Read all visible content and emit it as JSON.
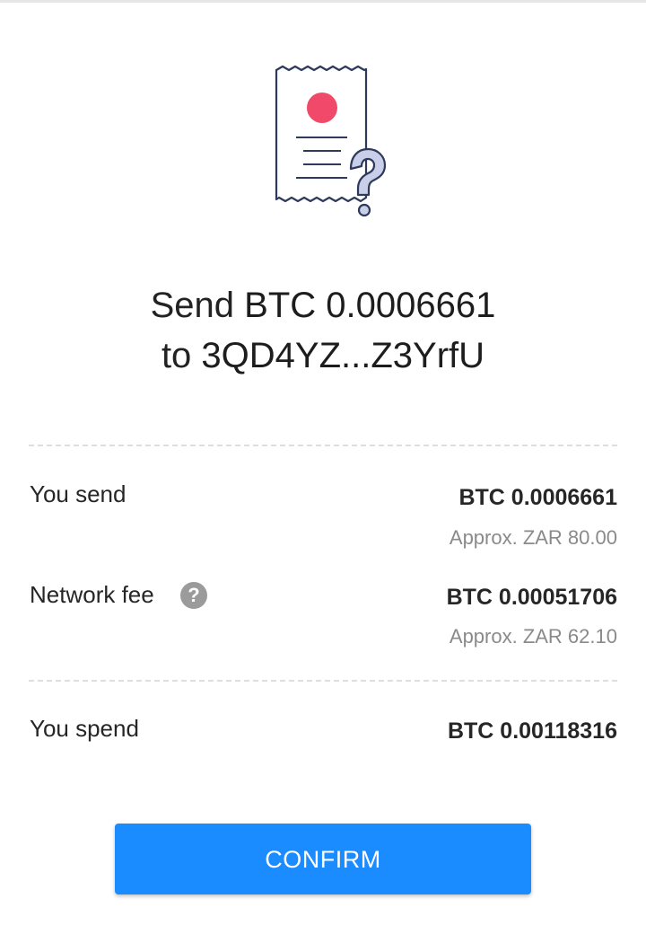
{
  "colors": {
    "accent": "#1a8cff",
    "receipt_stroke": "#2e3a5c",
    "receipt_dot": "#f0496a",
    "muted_text": "#8a8a8a"
  },
  "icons": {
    "illustration": "receipt-question-icon",
    "help": "help-circle-icon"
  },
  "header": {
    "send_word": "Send",
    "amount": "BTC 0.0006661",
    "to_word": "to",
    "address": "3QD4YZ...Z3YrfU"
  },
  "rows": {
    "you_send": {
      "label": "You send",
      "value": "BTC 0.0006661",
      "approx": "Approx. ZAR 80.00"
    },
    "network_fee": {
      "label": "Network fee",
      "value": "BTC 0.00051706",
      "approx": "Approx. ZAR 62.10"
    },
    "you_spend": {
      "label": "You spend",
      "value": "BTC 0.00118316"
    }
  },
  "confirm_label": "CONFIRM"
}
